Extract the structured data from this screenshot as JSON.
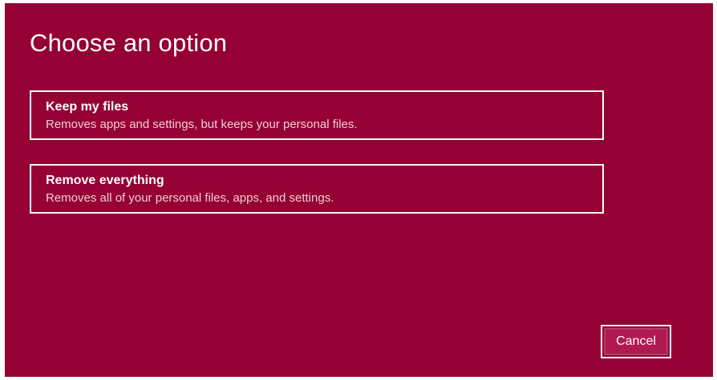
{
  "dialog": {
    "title": "Choose an option",
    "background_color": "#950035",
    "options": [
      {
        "title": "Keep my files",
        "description": "Removes apps and settings, but keeps your personal files."
      },
      {
        "title": "Remove everything",
        "description": "Removes all of your personal files, apps, and settings."
      }
    ],
    "cancel_label": "Cancel"
  }
}
